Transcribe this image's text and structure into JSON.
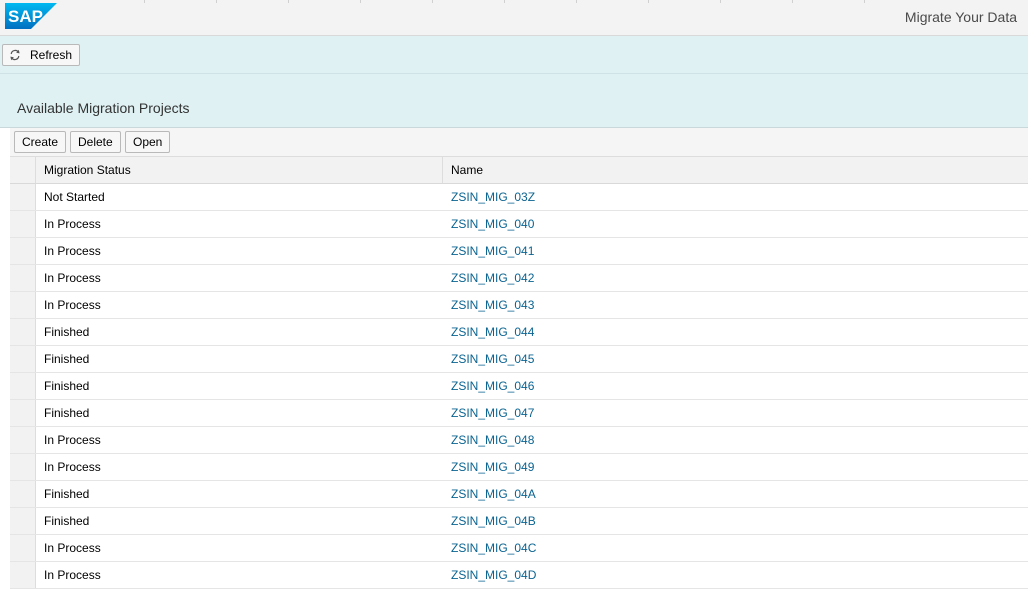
{
  "header": {
    "logo_text": "SAP",
    "app_title": "Migrate Your Data",
    "brand_color": "#008fd3"
  },
  "toolbar": {
    "refresh_label": "Refresh",
    "refresh_icon": "refresh-icon"
  },
  "section": {
    "title": "Available Migration Projects"
  },
  "table_toolbar": {
    "create_label": "Create",
    "delete_label": "Delete",
    "open_label": "Open"
  },
  "table": {
    "columns": [
      "Migration Status",
      "Name"
    ],
    "rows": [
      {
        "status": "Not Started",
        "name": "ZSIN_MIG_03Z"
      },
      {
        "status": "In Process",
        "name": "ZSIN_MIG_040"
      },
      {
        "status": "In Process",
        "name": "ZSIN_MIG_041"
      },
      {
        "status": "In Process",
        "name": "ZSIN_MIG_042"
      },
      {
        "status": "In Process",
        "name": "ZSIN_MIG_043"
      },
      {
        "status": "Finished",
        "name": "ZSIN_MIG_044"
      },
      {
        "status": "Finished",
        "name": "ZSIN_MIG_045"
      },
      {
        "status": "Finished",
        "name": "ZSIN_MIG_046"
      },
      {
        "status": "Finished",
        "name": "ZSIN_MIG_047"
      },
      {
        "status": "In Process",
        "name": "ZSIN_MIG_048"
      },
      {
        "status": "In Process",
        "name": "ZSIN_MIG_049"
      },
      {
        "status": "Finished",
        "name": "ZSIN_MIG_04A"
      },
      {
        "status": "Finished",
        "name": "ZSIN_MIG_04B"
      },
      {
        "status": "In Process",
        "name": "ZSIN_MIG_04C"
      },
      {
        "status": "In Process",
        "name": "ZSIN_MIG_04D"
      }
    ]
  }
}
